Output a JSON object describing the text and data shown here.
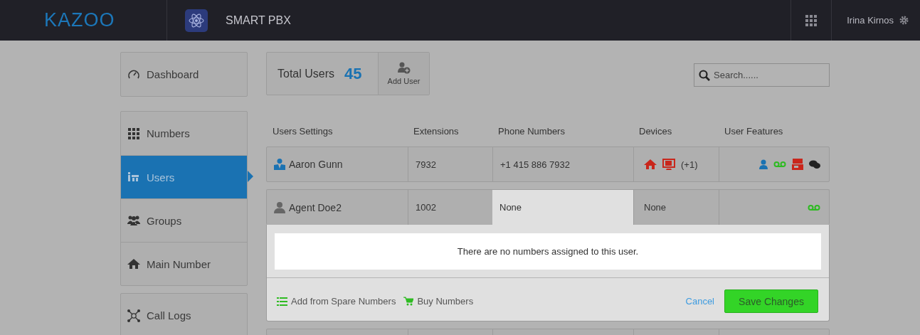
{
  "header": {
    "logo": "KAZOO",
    "app_title": "SMART PBX",
    "user_name": "Irina Kirnos"
  },
  "sidebar": {
    "groups": [
      [
        {
          "label": "Dashboard",
          "kind": "gauge",
          "selected": false
        }
      ],
      [
        {
          "label": "Numbers",
          "kind": "grid",
          "selected": false
        },
        {
          "label": "Users",
          "kind": "users",
          "selected": true
        },
        {
          "label": "Groups",
          "kind": "group",
          "selected": false
        },
        {
          "label": "Main Number",
          "kind": "home",
          "selected": false
        }
      ],
      [
        {
          "label": "Call Logs",
          "kind": "nodes",
          "selected": false
        }
      ]
    ]
  },
  "summary": {
    "label": "Total Users",
    "count": "45",
    "add_label": "Add User"
  },
  "search": {
    "placeholder": "Search......"
  },
  "table": {
    "columns": [
      "Users Settings",
      "Extensions",
      "Phone Numbers",
      "Devices",
      "User Features"
    ],
    "rows": [
      {
        "avatar": {
          "kind": "admin"
        },
        "name": "Aaron Gunn",
        "extension": "7932",
        "phone_numbers": {
          "text": "+1 415 886 7932",
          "selected": false
        },
        "devices": [
          {
            "kind": "home"
          },
          {
            "kind": "softphone"
          }
        ],
        "devices_text": "(+1)",
        "features": [
          {
            "kind": "user"
          },
          {
            "kind": "voicemail"
          },
          {
            "kind": "fax"
          },
          {
            "kind": "chat"
          }
        ],
        "expanded": false
      },
      {
        "avatar": {
          "kind": "user"
        },
        "name": "Agent Doe2",
        "extension": "1002",
        "phone_numbers": {
          "text": "None",
          "selected": true
        },
        "devices_text": "None",
        "features": [
          {
            "kind": "voicemail"
          }
        ],
        "expanded": true,
        "detail": {
          "message": "There are no numbers assigned to this user.",
          "actions": [
            {
              "kind": "list",
              "label": "Add from Spare Numbers"
            },
            {
              "kind": "cart",
              "label": "Buy Numbers"
            }
          ],
          "cancel": "Cancel",
          "save": "Save Changes"
        }
      }
    ]
  }
}
